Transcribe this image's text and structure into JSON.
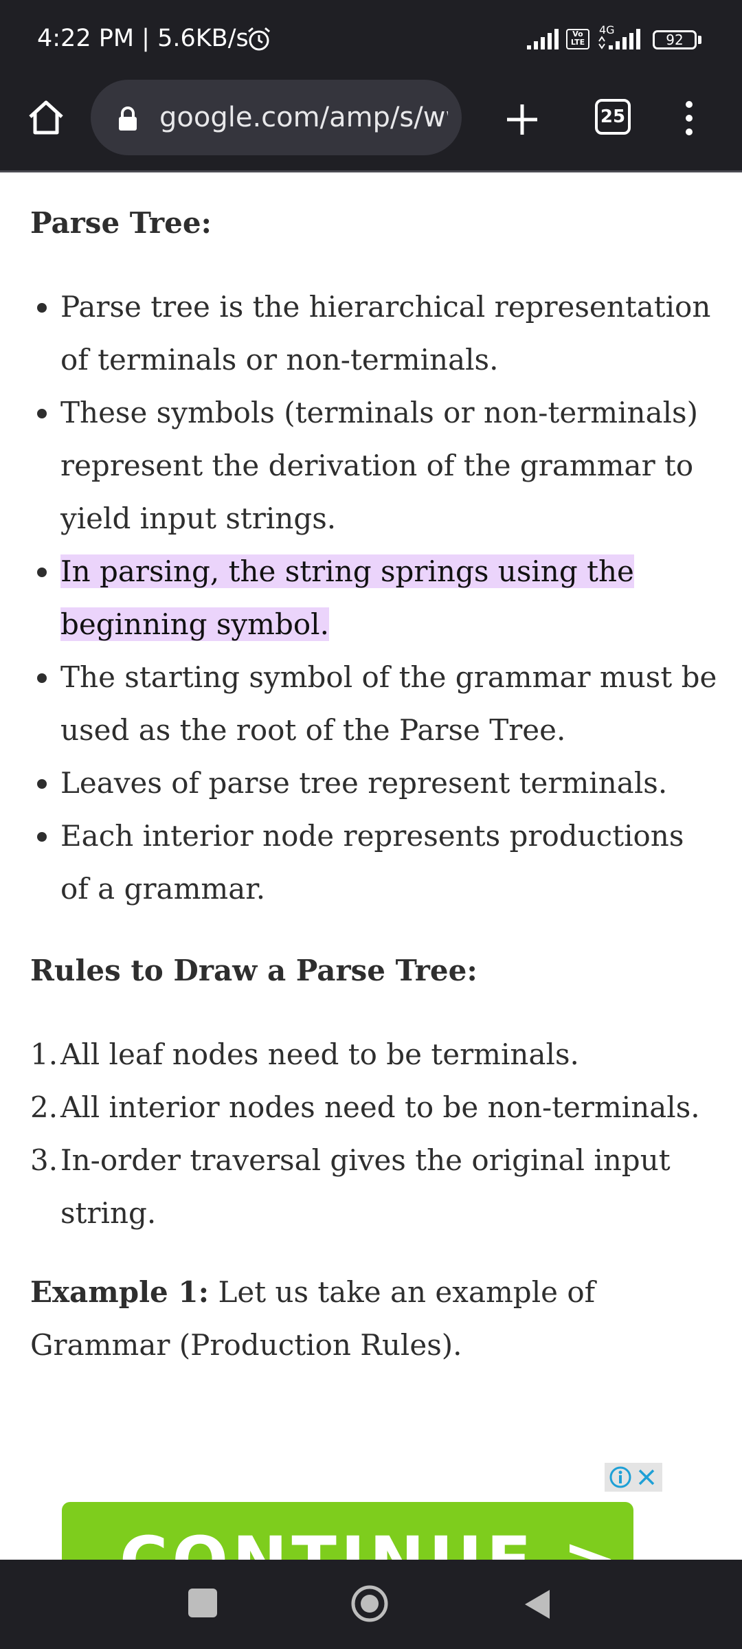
{
  "status_bar": {
    "time": "4:22 PM | 5.6KB/s",
    "volte": "Vo LTE",
    "network": "4G",
    "battery": "92"
  },
  "toolbar": {
    "url": "google.com/amp/s/www.geeksforgeeks.org",
    "tab_count": "25"
  },
  "article": {
    "parse_tree_heading": "Parse Tree:",
    "parse_tree_bullets": [
      "Parse tree is the hierarchical representation of terminals or non-terminals.",
      "These symbols (terminals or non-terminals) represent the derivation of the grammar to yield input strings.",
      "In parsing, the string springs using the beginning symbol.",
      "The starting symbol of the grammar must be used as the root of the Parse Tree.",
      "Leaves of parse tree represent terminals.",
      "Each interior node represents productions of a grammar."
    ],
    "rules_heading": "Rules to Draw a Parse Tree:",
    "rules": [
      {
        "marker": "1.",
        "text": "All leaf nodes need to be terminals."
      },
      {
        "marker": "2.",
        "text": "All interior nodes need to be non-terminals."
      },
      {
        "marker": "3.",
        "text": "In-order traversal gives the original input string."
      }
    ],
    "example_label": "Example 1:",
    "example_text": " Let us take an example of Grammar (Production Rules)."
  },
  "ad": {
    "banner_text": "CONTINUE >"
  },
  "colors": {
    "highlight": "#ebd4fb",
    "bar_background": "#1f1f24",
    "ad_green": "#7ecd1d"
  }
}
